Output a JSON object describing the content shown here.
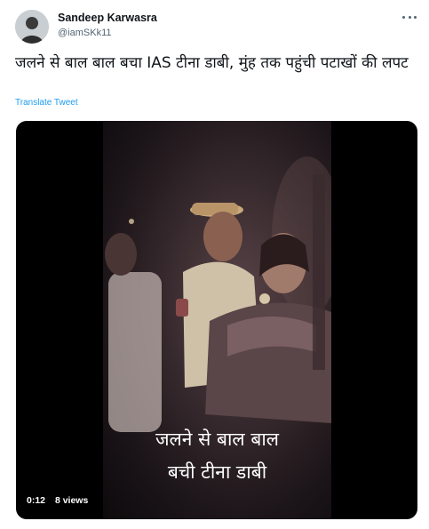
{
  "user": {
    "display_name": "Sandeep Karwasra",
    "handle": "@iamSKk11"
  },
  "tweet": {
    "text": "जलने से बाल बाल बचा IAS टीना डाबी, मुंह तक पहुंची पटाखों की लपट",
    "translate_label": "Translate Tweet"
  },
  "media": {
    "caption_line1": "जलने से बाल बाल",
    "caption_line2": "बची टीना डाबी",
    "duration": "0:12",
    "views": "8 views"
  },
  "icons": {
    "more": "more-horizontal-icon"
  },
  "colors": {
    "link": "#1d9bf0",
    "secondary_text": "#536471",
    "media_bg": "#000000"
  }
}
